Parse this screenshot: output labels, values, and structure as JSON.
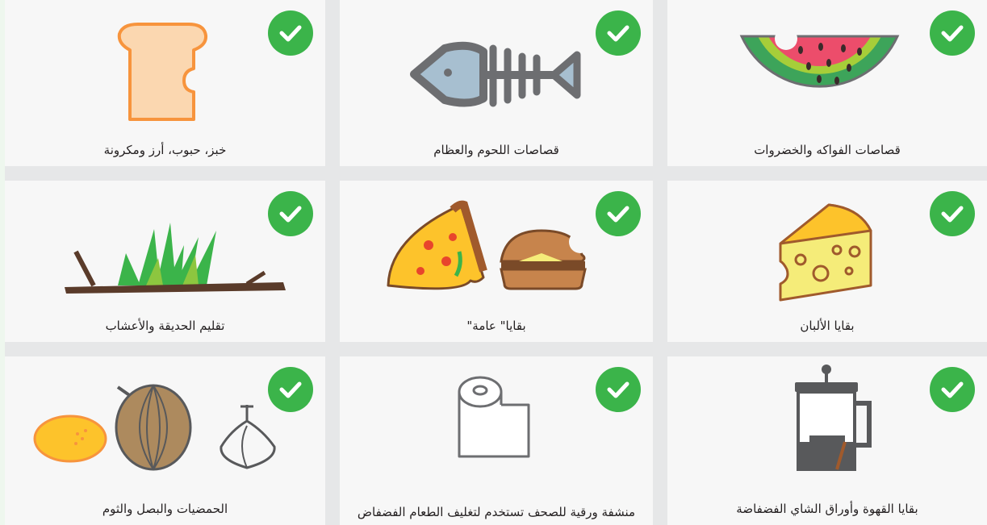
{
  "cards": [
    {
      "label": "قصاصات الفواكه والخضروات",
      "icon": "watermelon-icon"
    },
    {
      "label": "قصاصات اللحوم والعظام",
      "icon": "fish-bone-icon"
    },
    {
      "label": "خبز، حبوب، أرز ومكرونة",
      "icon": "bread-icon"
    },
    {
      "label": "بقايا الألبان",
      "icon": "cheese-icon"
    },
    {
      "label": "\"بقايا\" عامة",
      "icon": "pizza-burger-icon"
    },
    {
      "label": "تقليم الحديقة والأعشاب",
      "icon": "branch-grass-icon"
    },
    {
      "label": "بقايا القهوة وأوراق الشاي الفضفاضة",
      "icon": "french-press-icon"
    },
    {
      "label": "منشفة ورقية للصحف تستخدم لتغليف الطعام الفضفاض",
      "icon": "paper-towel-icon"
    },
    {
      "label": "الحمضيات والبصل والثوم",
      "icon": "citrus-onion-garlic-icon"
    }
  ],
  "colors": {
    "check": "#3bb44a",
    "card_bg": "#f7f7f7",
    "gutter": "#e6e7e8"
  }
}
